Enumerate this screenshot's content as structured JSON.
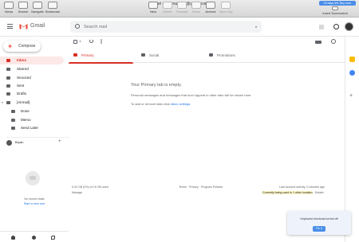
{
  "window": {
    "title": "Gmail - gosyou7163@gmail.com",
    "trial_badge": "15 days left. Buy now.",
    "toolbar_left": [
      {
        "label": "Views",
        "dim": false
      },
      {
        "label": "Search",
        "dim": false
      },
      {
        "label": "Navigate",
        "dim": false
      },
      {
        "label": "Bookmark",
        "dim": false
      }
    ],
    "toolbar_center": [
      {
        "label": "New",
        "dim": false
      },
      {
        "label": "Delete",
        "dim": true
      },
      {
        "label": "Forward",
        "dim": true
      },
      {
        "label": "Move",
        "dim": true
      },
      {
        "label": "Archive",
        "dim": false
      },
      {
        "label": "Save Clip",
        "dim": true
      }
    ],
    "toolbar_right": {
      "label": "Insert Screenshot"
    }
  },
  "header": {
    "app_name": "Gmail",
    "search_placeholder": "Search mail"
  },
  "sidebar": {
    "compose_label": "Compose",
    "items": [
      {
        "label": "Inbox",
        "active": true
      },
      {
        "label": "Starred",
        "active": false
      },
      {
        "label": "Snoozed",
        "active": false
      },
      {
        "label": "Sent",
        "active": false
      },
      {
        "label": "Drafts",
        "active": false
      },
      {
        "label": "[Airmail]",
        "active": false
      }
    ],
    "subitems": [
      {
        "label": "Done"
      },
      {
        "label": "Memo"
      },
      {
        "label": "Send Later"
      }
    ],
    "hangouts_user": "Bryan",
    "no_chats": "No recent chats",
    "start_chat": "Start a new one"
  },
  "tabs": [
    {
      "label": "Primary",
      "active": true
    },
    {
      "label": "Social",
      "active": false
    },
    {
      "label": "Promotions",
      "active": false
    }
  ],
  "empty_state": {
    "title": "Your Primary tab is empty.",
    "description": "Personal messages and messages that don't appear in other tabs will be shown here.",
    "add_prefix": "To add or remove tabs click ",
    "add_link": "inbox settings",
    "add_suffix": "."
  },
  "footer": {
    "storage": "0.02 GB (0%) of 15 GB used",
    "manage": "Manage",
    "links": "Terms · Privacy · Program Policies",
    "last_activity": "Last account activity: 0 minutes ago",
    "current_session_highlight": "Currently being used in 1 other location",
    "current_session_details": " · Details"
  },
  "toast": {
    "message": "Keyboard shortcuts turned off",
    "button": "Fix it"
  },
  "colors": {
    "accent_red": "#d93025",
    "link_blue": "#1a73e8",
    "toast_blue": "#4a8ee8"
  }
}
